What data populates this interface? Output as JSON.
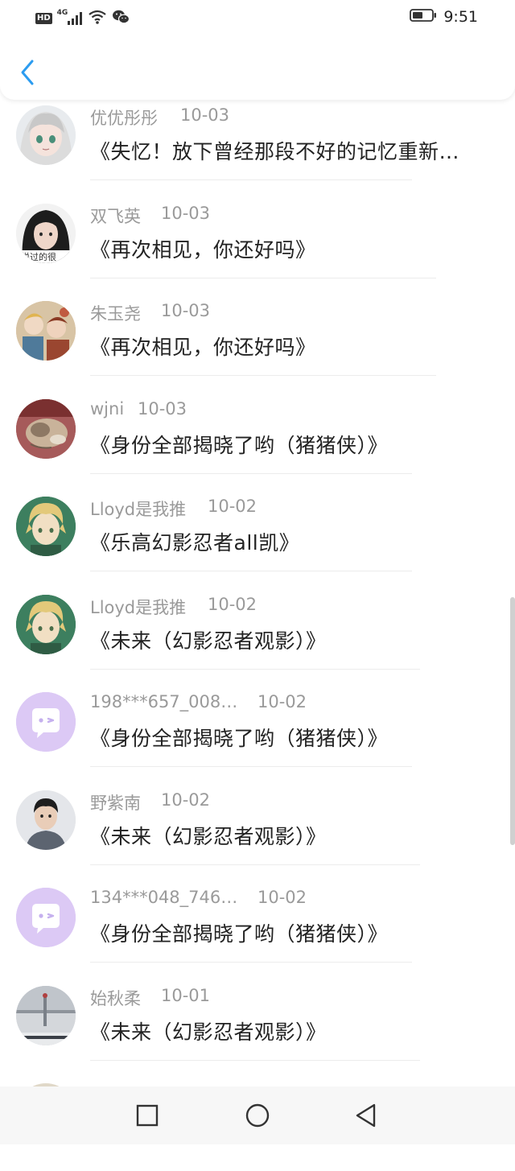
{
  "status_bar": {
    "hd": "HD",
    "network": "4G",
    "time": "9:51"
  },
  "header": {
    "back_icon": "chevron-left-icon",
    "accent": "#2c9cf0"
  },
  "items": [
    {
      "name": "优优彤彤",
      "date": "10-03",
      "title": "《失忆！放下曾经那段不好的记忆重新…",
      "avatar": "anime-girl-avatar"
    },
    {
      "name": "双飞英",
      "date": "10-03",
      "title": "《再次相见，你还好吗》",
      "avatar": "photo-avatar",
      "avatar_caption": "说过的很"
    },
    {
      "name": "朱玉尧",
      "date": "10-03",
      "title": "《再次相见，你还好吗》",
      "avatar": "anime-group-avatar"
    },
    {
      "name": "wjni",
      "date": "10-03",
      "title": "《身份全部揭晓了哟（猪猪侠）》",
      "avatar": "cat-avatar"
    },
    {
      "name": "Lloyd是我推",
      "date": "10-02",
      "title": "《乐高幻影忍者all凯》",
      "avatar": "anime-boy-avatar"
    },
    {
      "name": "Lloyd是我推",
      "date": "10-02",
      "title": "《未来（幻影忍者观影）》",
      "avatar": "anime-boy-avatar"
    },
    {
      "name": "198***657_008…",
      "date": "10-02",
      "title": "《身份全部揭晓了哟（猪猪侠）》",
      "avatar": "default-chat-avatar"
    },
    {
      "name": "野紫南",
      "date": "10-02",
      "title": "《未来（幻影忍者观影）》",
      "avatar": "photo-boy-avatar"
    },
    {
      "name": "134***048_746…",
      "date": "10-02",
      "title": "《身份全部揭晓了哟（猪猪侠）》",
      "avatar": "default-chat-avatar"
    },
    {
      "name": "始秋柔",
      "date": "10-01",
      "title": "《未来（幻影忍者观影）》",
      "avatar": "scenery-avatar"
    }
  ],
  "nav_bar": {
    "recent_icon": "square-icon",
    "home_icon": "circle-icon",
    "back_icon": "triangle-back-icon"
  }
}
